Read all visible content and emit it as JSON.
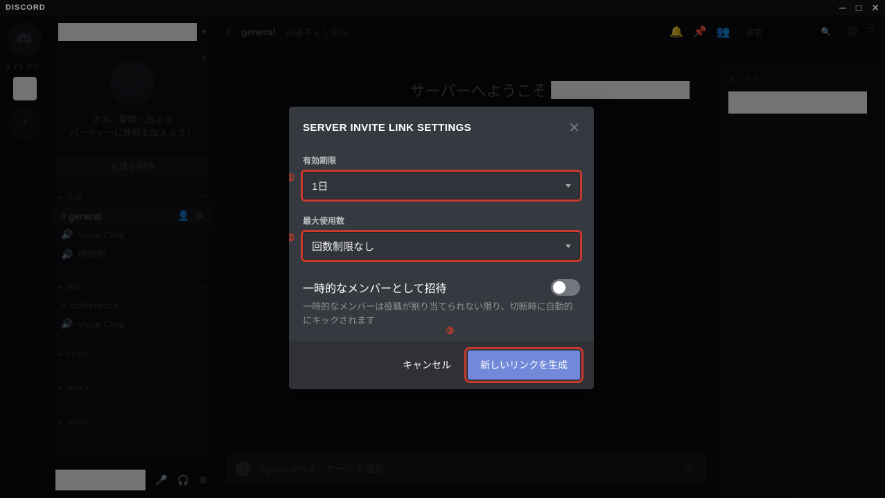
{
  "brand": "DISCORD",
  "rail": {
    "dm_label": "ダイレクト..."
  },
  "sidebar": {
    "promo_line1": "さぁ、冒険へ出よう",
    "promo_line2": "パーティーに仲間を加えよう！",
    "invite_friends": "友達を招待",
    "categories": [
      {
        "name": "共通",
        "channels": [
          {
            "type": "hash",
            "name": "general",
            "selected": true
          },
          {
            "type": "voice",
            "name": "Voice Chat"
          },
          {
            "type": "voice",
            "name": "待機所"
          }
        ]
      },
      {
        "name": "雑談",
        "channels": [
          {
            "type": "hash",
            "name": "conference"
          },
          {
            "type": "voice",
            "name": "Voice Chat"
          }
        ]
      },
      {
        "name": "PUBG",
        "channels": []
      },
      {
        "name": "MHXX",
        "channels": []
      },
      {
        "name": "WoWs",
        "channels": []
      }
    ]
  },
  "header": {
    "channel": "general",
    "desc": "共通チャンネル",
    "search_placeholder": "検索"
  },
  "welcome_prefix": "サーバーへようこそ",
  "msg_placeholder": "#generalへメッセージを送信",
  "members": {
    "heading": "オンライン - 1"
  },
  "modal": {
    "title": "SERVER INVITE LINK SETTINGS",
    "expiry_label": "有効期限",
    "expiry_value": "1日",
    "maxuses_label": "最大使用数",
    "maxuses_value": "回数制限なし",
    "temp_label": "一時的なメンバーとして招待",
    "temp_desc": "一時的なメンバーは役職が割り当てられない限り、切断時に自動的にキックされます",
    "annotation1": "①",
    "annotation2": "②",
    "annotation3": "③",
    "cancel": "キャンセル",
    "generate": "新しいリンクを生成"
  }
}
